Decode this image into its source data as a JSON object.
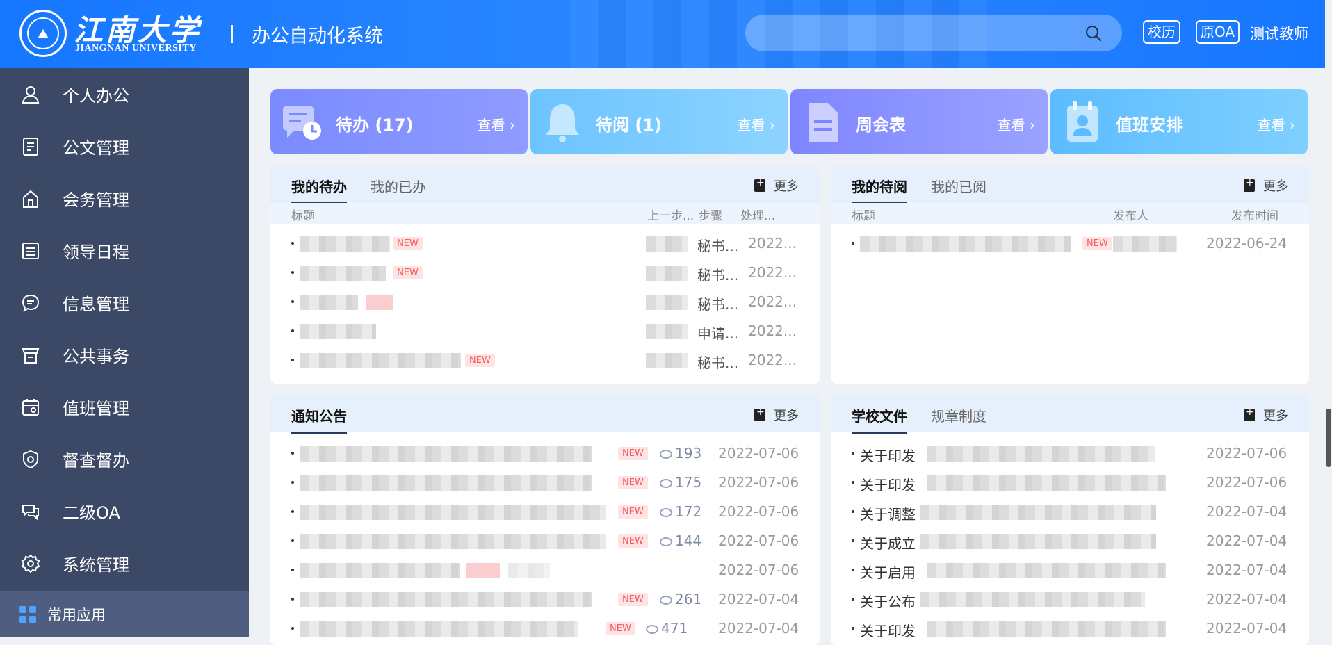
{
  "header": {
    "logo_cn": "江南大学",
    "logo_en": "JIANGNAN UNIVERSITY",
    "app_title": "办公自动化系统",
    "btn_calendar": "校历",
    "btn_old_oa": "原OA",
    "user": "测试教师"
  },
  "sidebar": {
    "items": [
      {
        "label": "个人办公",
        "icon": "person-icon"
      },
      {
        "label": "公文管理",
        "icon": "document-icon"
      },
      {
        "label": "会务管理",
        "icon": "building-icon"
      },
      {
        "label": "领导日程",
        "icon": "list-icon"
      },
      {
        "label": "信息管理",
        "icon": "chat-icon"
      },
      {
        "label": "公共事务",
        "icon": "shop-icon"
      },
      {
        "label": "值班管理",
        "icon": "calendar-icon"
      },
      {
        "label": "督查督办",
        "icon": "shield-icon"
      },
      {
        "label": "二级OA",
        "icon": "message-icon"
      },
      {
        "label": "系统管理",
        "icon": "gear-icon"
      }
    ],
    "footer": "常用应用"
  },
  "cards": [
    {
      "title": "待办 (17)",
      "view": "查看 ›",
      "icon": "todo-icon"
    },
    {
      "title": "待阅 (1)",
      "view": "查看 ›",
      "icon": "bell-icon"
    },
    {
      "title": "周会表",
      "view": "查看 ›",
      "icon": "file-icon"
    },
    {
      "title": "值班安排",
      "view": "查看 ›",
      "icon": "clipboard-user-icon"
    }
  ],
  "todo_panel": {
    "tabs": [
      "我的待办",
      "我的已办"
    ],
    "more": "更多",
    "headers": [
      "标题",
      "上一步...",
      "步骤",
      "处理..."
    ],
    "rows": [
      {
        "new": "NEW",
        "step": "秘书...",
        "date": "2022..."
      },
      {
        "new": "NEW",
        "step": "秘书...",
        "date": "2022..."
      },
      {
        "new": "",
        "step": "秘书...",
        "date": "2022..."
      },
      {
        "new": "",
        "step": "申请...",
        "date": "2022..."
      },
      {
        "new": "NEW",
        "step": "秘书...",
        "date": "2022..."
      }
    ]
  },
  "read_panel": {
    "tabs": [
      "我的待阅",
      "我的已阅"
    ],
    "more": "更多",
    "headers": [
      "标题",
      "发布人",
      "发布时间"
    ],
    "rows": [
      {
        "new": "NEW",
        "date": "2022-06-24"
      }
    ]
  },
  "notice_panel": {
    "tabs": [
      "通知公告"
    ],
    "more": "更多",
    "rows": [
      {
        "new": "NEW",
        "views": "193",
        "date": "2022-07-06"
      },
      {
        "new": "NEW",
        "views": "175",
        "date": "2022-07-06"
      },
      {
        "new": "NEW",
        "views": "172",
        "date": "2022-07-06"
      },
      {
        "new": "NEW",
        "views": "144",
        "date": "2022-07-06"
      },
      {
        "new": "",
        "views": "",
        "date": "2022-07-06"
      },
      {
        "new": "NEW",
        "views": "261",
        "date": "2022-07-04"
      },
      {
        "new": "NEW",
        "views": "471",
        "date": "2022-07-04"
      }
    ]
  },
  "files_panel": {
    "tabs": [
      "学校文件",
      "规章制度"
    ],
    "more": "更多",
    "rows": [
      {
        "prefix": "关于印发",
        "date": "2022-07-06"
      },
      {
        "prefix": "关于印发",
        "date": "2022-07-06"
      },
      {
        "prefix": "关于调整",
        "date": "2022-07-04"
      },
      {
        "prefix": "关于成立",
        "date": "2022-07-04"
      },
      {
        "prefix": "关于启用",
        "date": "2022-07-04"
      },
      {
        "prefix": "关于公布",
        "date": "2022-07-04"
      },
      {
        "prefix": "关于印发",
        "date": "2022-07-04"
      }
    ]
  },
  "colors": {
    "header_blue": "#1677ff",
    "sidebar_bg": "#3b4866",
    "new_tag": "#f55b5b"
  }
}
